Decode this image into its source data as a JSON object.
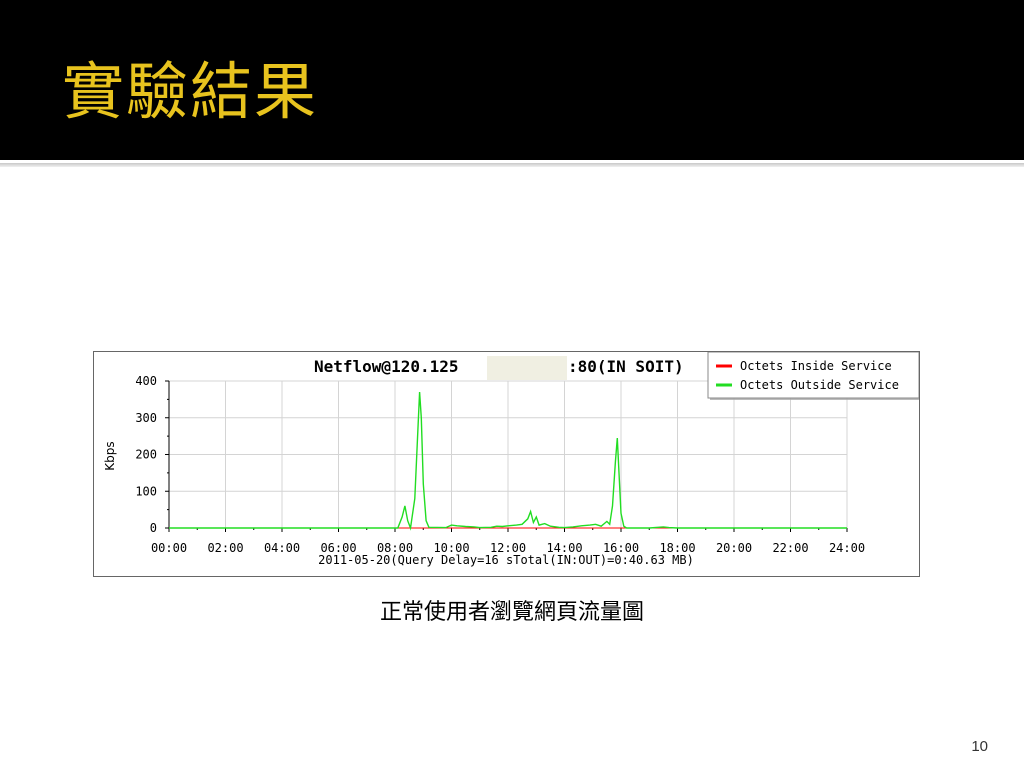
{
  "slide": {
    "title": "實驗結果",
    "caption": "正常使用者瀏覽網頁流量圖",
    "page_number": "10"
  },
  "colors": {
    "title_bar": "#000000",
    "title_text": "#e8c31e",
    "inside_series": "#ff0000",
    "outside_series": "#22dd22",
    "grid": "#d4d4d4"
  },
  "chart_data": {
    "type": "line",
    "title": "Netflow@120.125",
    "title_suffix": ":80(IN SOIT)",
    "title_redacted": true,
    "ylabel": "Kbps",
    "xlabel": "2011-05-20(Query Delay=16 sTotal(IN:OUT)=0:40.63 MB)",
    "x_ticks": [
      "00:00",
      "02:00",
      "04:00",
      "06:00",
      "08:00",
      "10:00",
      "12:00",
      "14:00",
      "16:00",
      "18:00",
      "20:00",
      "22:00",
      "24:00"
    ],
    "y_ticks": [
      "0",
      "100",
      "200",
      "300",
      "400"
    ],
    "ylim": [
      0,
      400
    ],
    "xlim_hours": [
      0,
      24
    ],
    "grid": true,
    "legend_position": "top-right",
    "series": [
      {
        "name": "Octets Inside Service",
        "color": "#ff0000",
        "points": [
          [
            0,
            0
          ],
          [
            24,
            0
          ]
        ]
      },
      {
        "name": "Octets Outside Service",
        "color": "#22dd22",
        "points": [
          [
            0,
            0
          ],
          [
            8.1,
            0
          ],
          [
            8.25,
            30
          ],
          [
            8.35,
            60
          ],
          [
            8.45,
            20
          ],
          [
            8.55,
            0
          ],
          [
            8.7,
            80
          ],
          [
            8.8,
            250
          ],
          [
            8.87,
            370
          ],
          [
            8.93,
            300
          ],
          [
            9.0,
            120
          ],
          [
            9.1,
            20
          ],
          [
            9.2,
            2
          ],
          [
            9.8,
            1
          ],
          [
            10.0,
            8
          ],
          [
            10.2,
            6
          ],
          [
            10.5,
            4
          ],
          [
            10.8,
            3
          ],
          [
            11.0,
            1
          ],
          [
            11.4,
            2
          ],
          [
            11.6,
            5
          ],
          [
            11.8,
            4
          ],
          [
            12.0,
            6
          ],
          [
            12.3,
            8
          ],
          [
            12.5,
            10
          ],
          [
            12.7,
            25
          ],
          [
            12.8,
            45
          ],
          [
            12.9,
            15
          ],
          [
            13.0,
            30
          ],
          [
            13.1,
            8
          ],
          [
            13.3,
            12
          ],
          [
            13.5,
            5
          ],
          [
            13.8,
            2
          ],
          [
            14.0,
            1
          ],
          [
            14.3,
            3
          ],
          [
            14.6,
            6
          ],
          [
            14.9,
            8
          ],
          [
            15.1,
            10
          ],
          [
            15.3,
            5
          ],
          [
            15.5,
            18
          ],
          [
            15.6,
            10
          ],
          [
            15.7,
            60
          ],
          [
            15.8,
            180
          ],
          [
            15.87,
            245
          ],
          [
            15.93,
            150
          ],
          [
            16.0,
            40
          ],
          [
            16.1,
            5
          ],
          [
            16.2,
            0
          ],
          [
            17.0,
            0
          ],
          [
            17.5,
            3
          ],
          [
            17.7,
            1
          ],
          [
            18.0,
            0
          ],
          [
            19.0,
            0
          ],
          [
            24,
            0
          ]
        ]
      }
    ]
  }
}
